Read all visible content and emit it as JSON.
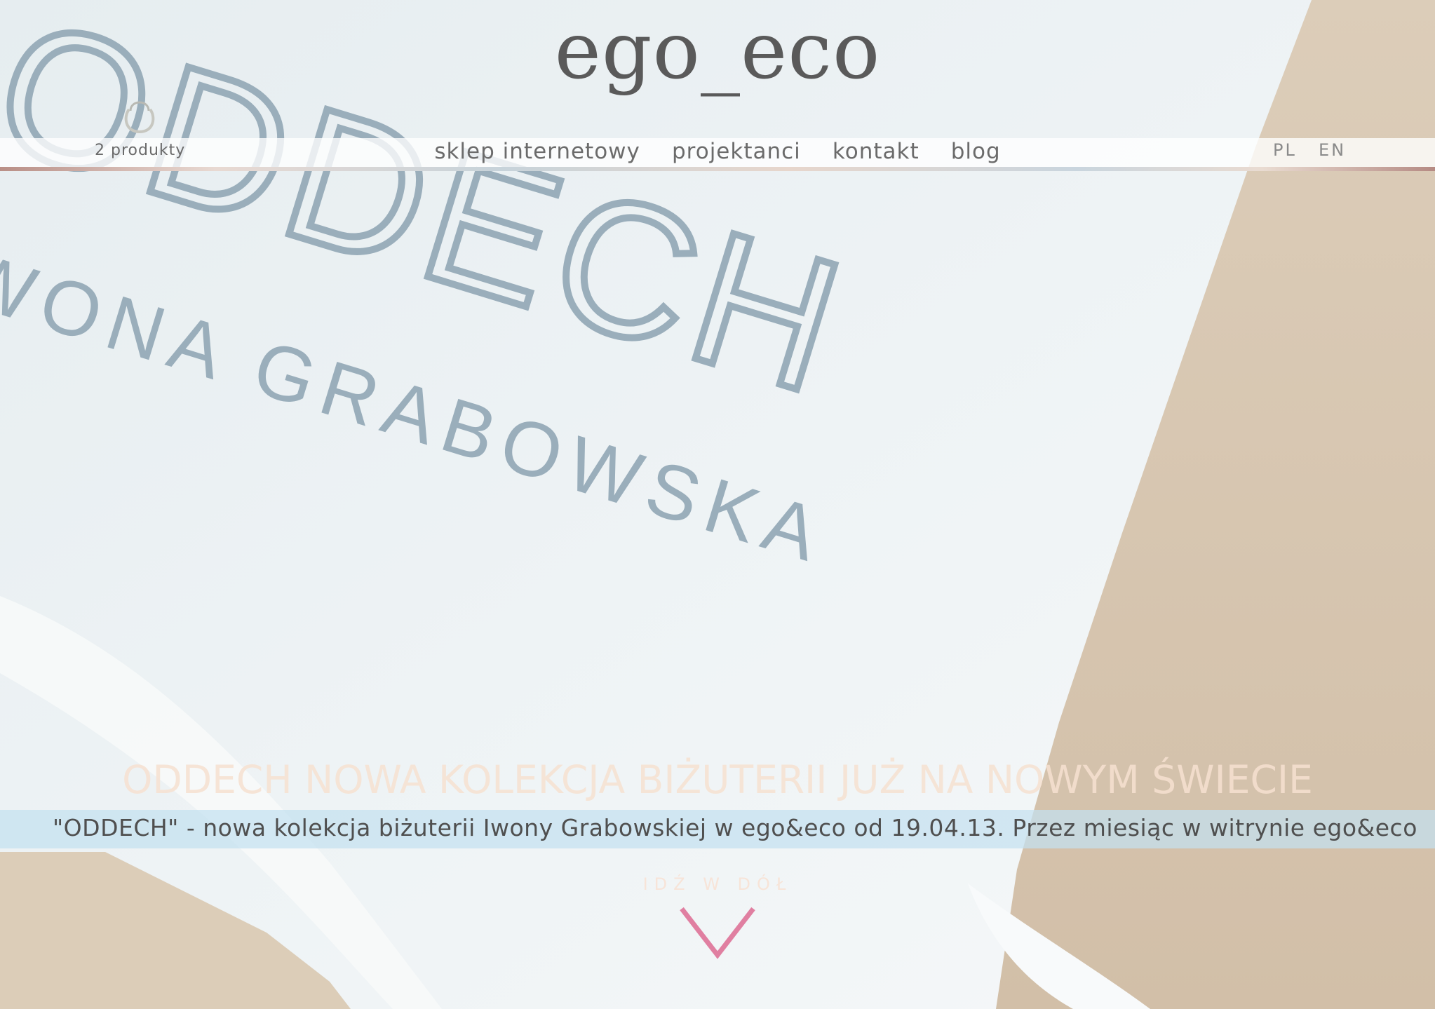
{
  "logo": "ego_eco",
  "cart": {
    "count_label": "2 produkty",
    "icon": "shopping-bag-icon"
  },
  "menu": [
    "sklep internetowy",
    "projektanci",
    "kontakt",
    "blog"
  ],
  "languages": [
    "PL",
    "EN"
  ],
  "hero": {
    "image_text_line1": "ODDECH",
    "image_text_line2": "IWONA GRABOWSKA",
    "headline": "ODDECH NOWA KOLEKCJA BIŻUTERII JUŻ NA NOWYM ŚWIECIE",
    "ticker": "\"ODDECH\" -  nowa kolekcja biżuterii Iwony Grabowskiej w ego&eco od 19.04.13.   Przez miesiąc w witrynie ego&eco",
    "scroll_label": "IDŹ W DÓŁ",
    "scroll_icon": "chevron-down-icon"
  },
  "colors": {
    "sand": "#d9c8b3",
    "arrow": "#e07fa1",
    "ticker_bg": "#c4e1f0"
  }
}
